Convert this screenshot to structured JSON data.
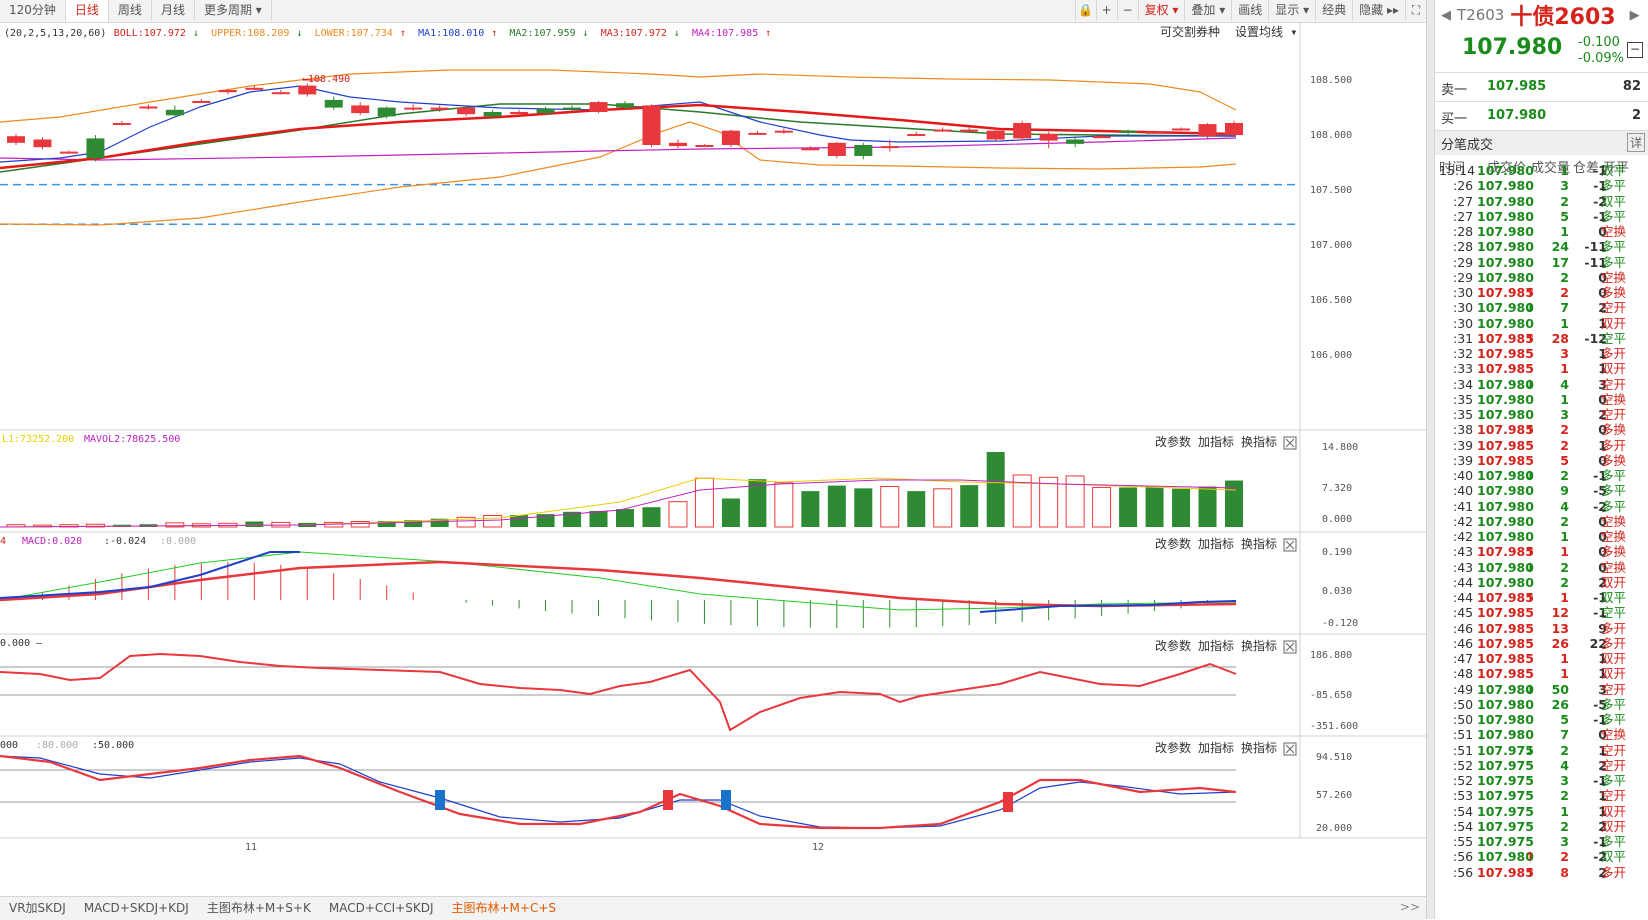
{
  "toolbar": {
    "tabs": [
      "120分钟",
      "日线",
      "周线",
      "月线",
      "更多周期 ▾"
    ],
    "active_tab": "日线",
    "right_buttons": [
      {
        "label": "复权 ▾",
        "name": "fuquan-button",
        "red": true
      },
      {
        "label": "叠加 ▾",
        "name": "overlay-button",
        "red": false
      },
      {
        "label": "画线",
        "name": "draw-line-button",
        "red": false
      },
      {
        "label": "显示 ▾",
        "name": "display-button",
        "red": false
      },
      {
        "label": "经典",
        "name": "classic-button",
        "red": false
      },
      {
        "label": "隐藏 ▸▸",
        "name": "hide-button",
        "red": false
      }
    ]
  },
  "main_chart": {
    "indicator_prefix": "(20,2,5,13,20,60)",
    "boll": "BOLL:107.972",
    "upper": "UPPER:108.209",
    "lower": "LOWER:107.734",
    "ma1": "MA1:108.010",
    "ma2": "MA2:107.959",
    "ma3": "MA3:107.972",
    "ma4": "MA4:107.985",
    "marker_high": "←108.490",
    "link_convertible": "可交割券种",
    "link_ma_settings": "设置均线 ▾",
    "y_ticks": [
      "108.500",
      "108.000",
      "107.500",
      "107.000",
      "106.500",
      "106.000"
    ],
    "dashed_levels": [
      107.54,
      107.18
    ],
    "candles": [
      [
        107.92,
        107.98,
        107.9,
        108.0
      ],
      [
        107.88,
        107.95,
        107.86,
        107.97
      ],
      [
        107.84,
        107.84,
        107.83,
        107.85
      ],
      [
        107.96,
        107.78,
        107.75,
        107.99
      ],
      [
        108.1,
        108.1,
        108.08,
        108.12
      ],
      [
        108.25,
        108.25,
        108.22,
        108.27
      ],
      [
        108.22,
        108.17,
        108.15,
        108.26
      ],
      [
        108.3,
        108.3,
        108.28,
        108.32
      ],
      [
        108.38,
        108.4,
        108.36,
        108.41
      ],
      [
        108.42,
        108.42,
        108.4,
        108.44
      ],
      [
        108.38,
        108.38,
        108.36,
        108.4
      ],
      [
        108.36,
        108.44,
        108.34,
        108.46
      ],
      [
        108.31,
        108.24,
        108.22,
        108.34
      ],
      [
        108.19,
        108.26,
        108.17,
        108.29
      ],
      [
        108.24,
        108.16,
        108.14,
        108.25
      ],
      [
        108.24,
        108.24,
        108.21,
        108.27
      ],
      [
        108.22,
        108.24,
        108.2,
        108.26
      ],
      [
        108.18,
        108.24,
        108.16,
        108.25
      ],
      [
        108.2,
        108.16,
        108.14,
        108.22
      ],
      [
        108.2,
        108.2,
        108.18,
        108.22
      ],
      [
        108.23,
        108.19,
        108.17,
        108.25
      ],
      [
        108.24,
        108.23,
        108.21,
        108.26
      ],
      [
        108.2,
        108.29,
        108.19,
        108.3
      ],
      [
        108.28,
        108.24,
        108.22,
        108.3
      ],
      [
        107.9,
        108.26,
        107.88,
        108.27
      ],
      [
        107.89,
        107.92,
        107.87,
        107.95
      ],
      [
        107.89,
        107.9,
        107.88,
        107.91
      ],
      [
        107.9,
        108.03,
        107.88,
        108.04
      ],
      [
        108.01,
        108.01,
        107.99,
        108.03
      ],
      [
        108.03,
        108.03,
        108.0,
        108.05
      ],
      [
        107.87,
        107.87,
        107.85,
        107.89
      ],
      [
        107.8,
        107.92,
        107.78,
        107.93
      ],
      [
        107.9,
        107.8,
        107.77,
        107.92
      ],
      [
        107.89,
        107.89,
        107.84,
        107.95
      ],
      [
        108.0,
        108.0,
        107.98,
        108.02
      ],
      [
        108.04,
        108.04,
        108.02,
        108.06
      ],
      [
        108.04,
        108.04,
        108.02,
        108.06
      ],
      [
        107.95,
        108.03,
        107.94,
        108.05
      ],
      [
        107.96,
        108.1,
        107.94,
        108.12
      ],
      [
        107.94,
        108.0,
        107.87,
        108.02
      ],
      [
        107.95,
        107.91,
        107.88,
        107.98
      ],
      [
        107.98,
        107.98,
        107.97,
        108.0
      ],
      [
        108.03,
        108.01,
        107.99,
        108.04
      ],
      [
        108.02,
        108.02,
        108.0,
        108.03
      ],
      [
        108.05,
        108.05,
        108.03,
        108.06
      ],
      [
        107.98,
        108.09,
        107.96,
        108.1
      ],
      [
        107.99,
        108.1,
        107.98,
        108.12
      ]
    ]
  },
  "vol_panel": {
    "label1": "L1:73252.200",
    "label2": "MAVOL2:78625.500",
    "y_ticks": [
      "14.800",
      "7.320",
      "0.000"
    ],
    "values": [
      0.5,
      0.4,
      0.5,
      0.6,
      0.5,
      0.6,
      0.9,
      0.7,
      0.8,
      1.2,
      1.0,
      0.9,
      1.0,
      1.2,
      1.3,
      1.5,
      1.8,
      2.1,
      2.5,
      2.6,
      2.8,
      3.3,
      3.5,
      3.9,
      4.3,
      5.5,
      10.6,
      6.2,
      10.4,
      9.6,
      7.8,
      9.0,
      8.4,
      8.8,
      7.8,
      8.3,
      9.1,
      16.3,
      11.3,
      10.8,
      11.1,
      8.6,
      8.6,
      8.6,
      8.3,
      8.8,
      10.1
    ],
    "up": [
      false,
      false,
      false,
      false,
      true,
      true,
      false,
      false,
      false,
      true,
      false,
      true,
      false,
      false,
      true,
      true,
      true,
      false,
      false,
      true,
      true,
      true,
      true,
      true,
      true,
      false,
      false,
      true,
      true,
      false,
      true,
      true,
      true,
      false,
      true,
      false,
      true,
      true,
      false,
      false,
      false,
      false,
      true,
      true,
      true,
      true,
      true
    ]
  },
  "macd_panel": {
    "label1": "4",
    "label2": "MACD:0.020",
    "label3": ":-0.024",
    "label4": ":0.000",
    "y_ticks": [
      "0.190",
      "0.030",
      "-0.120"
    ]
  },
  "cci_panel": {
    "label1": "0.000",
    "y_ticks": [
      "186.800",
      "-85.650",
      "-351.600"
    ]
  },
  "kdj_panel": {
    "label1": "000",
    "label2": ":80.000",
    "label3": ":50.000",
    "y_ticks": [
      "94.510",
      "57.260",
      "20.000"
    ]
  },
  "panel_buttons": [
    "改参数",
    "加指标",
    "换指标"
  ],
  "x_labels": [
    "11",
    "12"
  ],
  "bottom_tabs": [
    "VR加SKDJ",
    "MACD+SKDJ+KDJ",
    "主图布林+M+S+K",
    "MACD+CCI+SKDJ",
    "主图布林+M+C+S"
  ],
  "bottom_active": "主图布林+M+C+S",
  "quote": {
    "code": "T2603",
    "name": "十债2603",
    "price": "107.980",
    "change": "-0.100",
    "change_pct": "-0.09%",
    "sell_label": "卖一",
    "sell_price": "107.985",
    "sell_vol": "82",
    "buy_label": "买一",
    "buy_price": "107.980",
    "buy_vol": "2",
    "trades_title": "分笔成交",
    "detail_button": "详",
    "headers": [
      "时间",
      "成交价",
      "成交量",
      "仓差",
      "开平"
    ]
  },
  "trades": [
    [
      "15:14",
      "107.980",
      "",
      "1",
      "-1",
      "双平"
    ],
    [
      ":26",
      "107.980",
      "",
      "3",
      "-1",
      "多平"
    ],
    [
      ":27",
      "107.980",
      "",
      "2",
      "-2",
      "双平"
    ],
    [
      ":27",
      "107.980",
      "",
      "5",
      "-1",
      "多平"
    ],
    [
      ":28",
      "107.980",
      "",
      "1",
      "0",
      "空换"
    ],
    [
      ":28",
      "107.980",
      "",
      "24",
      "-11",
      "多平"
    ],
    [
      ":29",
      "107.980",
      "",
      "17",
      "-11",
      "多平"
    ],
    [
      ":29",
      "107.980",
      "",
      "2",
      "0",
      "空换"
    ],
    [
      ":30",
      "107.985",
      "↑",
      "2",
      "0",
      "多换"
    ],
    [
      ":30",
      "107.980",
      "↓",
      "7",
      "2",
      "空开"
    ],
    [
      ":30",
      "107.980",
      "",
      "1",
      "1",
      "双开"
    ],
    [
      ":31",
      "107.985",
      "↑",
      "28",
      "-12",
      "空平"
    ],
    [
      ":32",
      "107.985",
      "",
      "3",
      "1",
      "多开"
    ],
    [
      ":33",
      "107.985",
      "",
      "1",
      "1",
      "双开"
    ],
    [
      ":34",
      "107.980",
      "↓",
      "4",
      "3",
      "空开"
    ],
    [
      ":35",
      "107.980",
      "",
      "1",
      "0",
      "空换"
    ],
    [
      ":35",
      "107.980",
      "",
      "3",
      "2",
      "空开"
    ],
    [
      ":38",
      "107.985",
      "↑",
      "2",
      "0",
      "多换"
    ],
    [
      ":39",
      "107.985",
      "",
      "2",
      "1",
      "多开"
    ],
    [
      ":39",
      "107.985",
      "",
      "5",
      "0",
      "多换"
    ],
    [
      ":40",
      "107.980",
      "↓",
      "2",
      "-1",
      "多平"
    ],
    [
      ":40",
      "107.980",
      "",
      "9",
      "-5",
      "多平"
    ],
    [
      ":41",
      "107.980",
      "",
      "4",
      "-2",
      "多平"
    ],
    [
      ":42",
      "107.980",
      "",
      "2",
      "0",
      "空换"
    ],
    [
      ":42",
      "107.980",
      "",
      "1",
      "0",
      "空换"
    ],
    [
      ":43",
      "107.985",
      "↑",
      "1",
      "0",
      "多换"
    ],
    [
      ":43",
      "107.980",
      "↓",
      "2",
      "0",
      "空换"
    ],
    [
      ":44",
      "107.980",
      "",
      "2",
      "2",
      "双开"
    ],
    [
      ":44",
      "107.985",
      "↑",
      "1",
      "-1",
      "双平"
    ],
    [
      ":45",
      "107.985",
      "",
      "12",
      "-1",
      "空平"
    ],
    [
      ":46",
      "107.985",
      "",
      "13",
      "9",
      "多开"
    ],
    [
      ":46",
      "107.985",
      "",
      "26",
      "22",
      "多开"
    ],
    [
      ":47",
      "107.985",
      "",
      "1",
      "1",
      "双开"
    ],
    [
      ":48",
      "107.985",
      "",
      "1",
      "1",
      "双开"
    ],
    [
      ":49",
      "107.980",
      "↓",
      "50",
      "3",
      "空开"
    ],
    [
      ":50",
      "107.980",
      "",
      "26",
      "-5",
      "多平"
    ],
    [
      ":50",
      "107.980",
      "",
      "5",
      "-1",
      "多平"
    ],
    [
      ":51",
      "107.980",
      "",
      "7",
      "0",
      "空换"
    ],
    [
      ":51",
      "107.975",
      "↓",
      "2",
      "1",
      "空开"
    ],
    [
      ":52",
      "107.975",
      "",
      "4",
      "2",
      "空开"
    ],
    [
      ":52",
      "107.975",
      "",
      "3",
      "-1",
      "多平"
    ],
    [
      ":53",
      "107.975",
      "",
      "2",
      "1",
      "空开"
    ],
    [
      ":54",
      "107.975",
      "",
      "1",
      "1",
      "双开"
    ],
    [
      ":54",
      "107.975",
      "",
      "2",
      "2",
      "双开"
    ],
    [
      ":55",
      "107.975",
      "",
      "3",
      "-1",
      "多平"
    ],
    [
      ":56",
      "107.980",
      "↑",
      "2",
      "-2",
      "双平"
    ],
    [
      ":56",
      "107.985",
      "↑",
      "8",
      "2",
      "多开"
    ]
  ],
  "colors": {
    "up": "#e8383d",
    "down": "#2e8b34",
    "accent": "#d4241c",
    "ma1": "#1f3fcf",
    "ma2": "#2a7a2a",
    "ma3": "#e41a1a",
    "ma4": "#c020c0",
    "boll_band": "#f08a20"
  }
}
